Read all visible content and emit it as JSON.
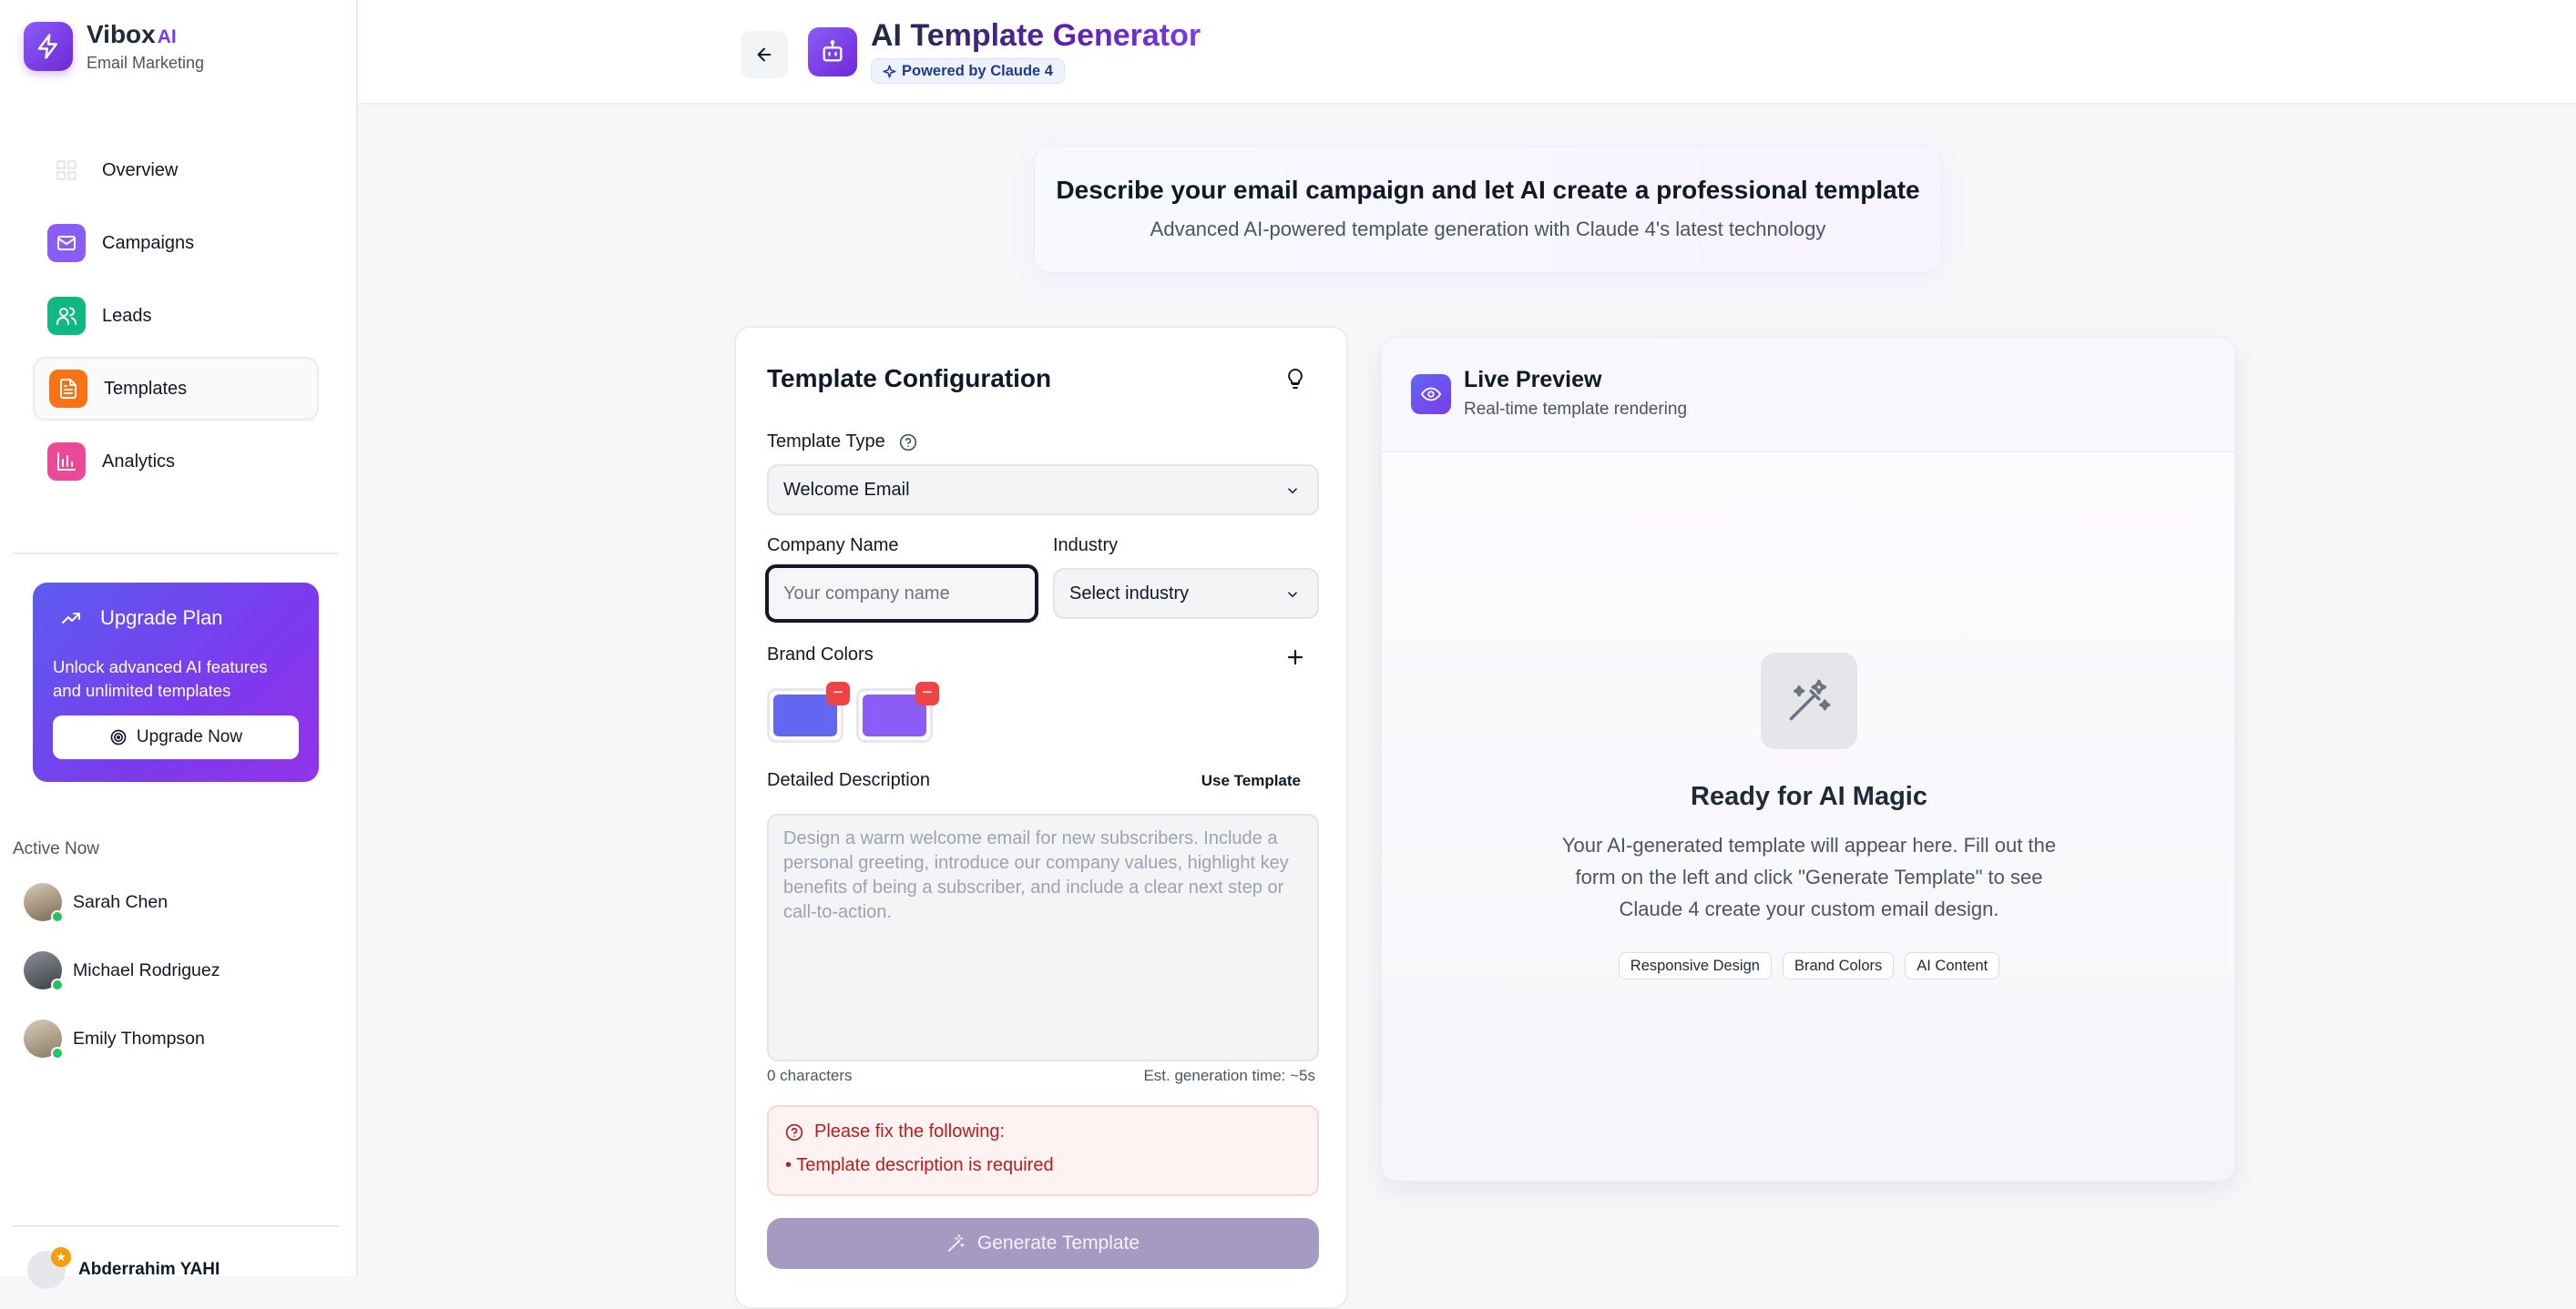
{
  "brand": {
    "name": "Vibox",
    "ai": "AI",
    "subtitle": "Email Marketing"
  },
  "sidebar": {
    "items": [
      {
        "label": "Overview",
        "icon": "grid-icon",
        "color": "#ffffff",
        "active": false
      },
      {
        "label": "Campaigns",
        "icon": "mail-icon",
        "color": "#8b5cf6",
        "active": false
      },
      {
        "label": "Leads",
        "icon": "users-icon",
        "color": "#10b981",
        "active": false
      },
      {
        "label": "Templates",
        "icon": "file-text-icon",
        "color": "#f97316",
        "active": true
      },
      {
        "label": "Analytics",
        "icon": "bar-chart-icon",
        "color": "#ec4899",
        "active": false
      }
    ],
    "upgrade": {
      "title": "Upgrade Plan",
      "description": "Unlock advanced AI features and unlimited templates",
      "button": "Upgrade Now"
    },
    "active_now": {
      "title": "Active Now",
      "users": [
        "Sarah Chen",
        "Michael Rodriguez",
        "Emily Thompson"
      ]
    },
    "current_user": "Abderrahim YAHI"
  },
  "header": {
    "title": "AI Template Generator",
    "badge": "Powered by Claude 4"
  },
  "intro": {
    "heading": "Describe your email campaign and let AI create a professional template",
    "subheading": "Advanced AI-powered template generation with Claude 4's latest technology"
  },
  "config": {
    "title": "Template Configuration",
    "template_type_label": "Template Type",
    "template_type_value": "Welcome Email",
    "company_label": "Company Name",
    "company_placeholder": "Your company name",
    "industry_label": "Industry",
    "industry_value": "Select industry",
    "brand_colors_label": "Brand Colors",
    "brand_colors": [
      "#6366f1",
      "#8b5cf6"
    ],
    "description_label": "Detailed Description",
    "use_template": "Use Template",
    "description_placeholder": "Design a warm welcome email for new subscribers. Include a personal greeting, introduce our company values, highlight key benefits of being a subscriber, and include a clear next step or call-to-action.",
    "char_count": "0 characters",
    "est_time": "Est. generation time: ~5s",
    "error_title": "Please fix the following:",
    "error_item": "• Template description is required",
    "generate_button": "Generate Template"
  },
  "preview": {
    "title": "Live Preview",
    "subtitle": "Real-time template rendering",
    "empty_title": "Ready for AI Magic",
    "empty_desc": "Your AI-generated template will appear here. Fill out the form on the left and click \"Generate Template\" to see Claude 4 create your custom email design.",
    "tags": [
      "Responsive Design",
      "Brand Colors",
      "AI Content"
    ]
  }
}
